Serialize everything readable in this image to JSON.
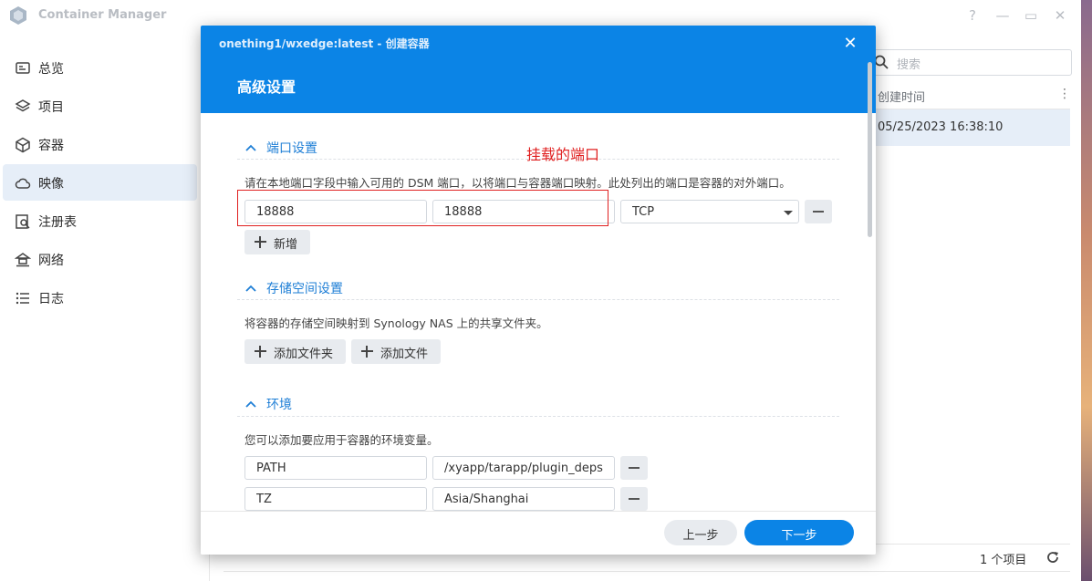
{
  "app": {
    "title": "Container Manager",
    "window_controls": [
      "?",
      "—",
      "▭",
      "✕"
    ]
  },
  "sidebar": {
    "items": [
      {
        "label": "总览",
        "icon": "overview-icon"
      },
      {
        "label": "项目",
        "icon": "project-icon"
      },
      {
        "label": "容器",
        "icon": "container-icon"
      },
      {
        "label": "映像",
        "icon": "image-cloud-icon",
        "active": true
      },
      {
        "label": "注册表",
        "icon": "registry-icon"
      },
      {
        "label": "网络",
        "icon": "network-icon"
      },
      {
        "label": "日志",
        "icon": "log-icon"
      }
    ]
  },
  "list": {
    "search_placeholder": "搜索",
    "column_header": "创建时间",
    "rows": [
      "05/25/2023 16:38:10"
    ],
    "item_count": "1 个项目"
  },
  "dialog": {
    "title": "onething1/wxedge:latest - 创建容器",
    "subtitle": "高级设置",
    "ports": {
      "section_label": "端口设置",
      "description": "请在本地端口字段中输入可用的 DSM 端口，以将端口与容器端口映射。此处列出的端口是容器的对外端口。",
      "local_port": "18888",
      "container_port": "18888",
      "protocol": "TCP",
      "add_label": "新增",
      "annotation": "挂载的端口"
    },
    "storage": {
      "section_label": "存储空间设置",
      "description": "将容器的存储空间映射到 Synology NAS 上的共享文件夹。",
      "add_folder_label": "添加文件夹",
      "add_file_label": "添加文件"
    },
    "env": {
      "section_label": "环境",
      "description": "您可以添加要应用于容器的环境变量。",
      "vars": [
        {
          "key": "PATH",
          "value": "/xyapp/tarapp/plugin_deps"
        },
        {
          "key": "TZ",
          "value": "Asia/Shanghai"
        }
      ]
    },
    "prev_label": "上一步",
    "next_label": "下一步"
  },
  "colors": {
    "accent": "#0b84e6",
    "annotation": "#e02020",
    "active_nav": "#e6eef8"
  }
}
